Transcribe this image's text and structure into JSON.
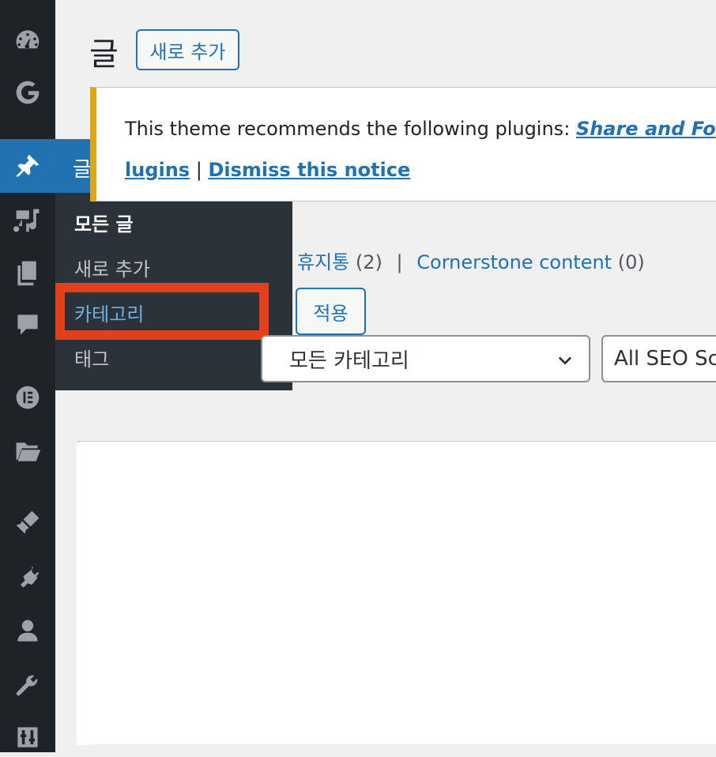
{
  "sidebar": {
    "icons": [
      {
        "name": "dashboard-icon"
      },
      {
        "name": "google-icon"
      },
      {
        "name": "posts-pin-icon",
        "active": true
      },
      {
        "name": "media-icon"
      },
      {
        "name": "pages-icon"
      },
      {
        "name": "comments-icon"
      },
      {
        "name": "elementor-icon"
      },
      {
        "name": "folder-icon"
      },
      {
        "name": "appearance-brush-icon"
      },
      {
        "name": "plugins-icon"
      },
      {
        "name": "users-icon"
      },
      {
        "name": "tools-wrench-icon"
      },
      {
        "name": "settings-sliders-icon"
      }
    ]
  },
  "flyout": {
    "title": "글",
    "items": [
      {
        "label": "모든 글",
        "current": true
      },
      {
        "label": "새로 추가"
      },
      {
        "label": "카테고리",
        "highlighted": true
      },
      {
        "label": "태그"
      }
    ]
  },
  "header": {
    "title": "글",
    "add_new": "새로 추가"
  },
  "notice": {
    "text": "This theme recommends the following plugins: ",
    "plugin_link": "Share and Fo",
    "install_link": "lugins",
    "separator": "|",
    "dismiss_link": "Dismiss this notice"
  },
  "filters": {
    "trash_label": "휴지통",
    "trash_count": "(2)",
    "separator": "|",
    "cornerstone_label": "Cornerstone content",
    "cornerstone_count": "(0)"
  },
  "bulk": {
    "apply_label": "적용"
  },
  "selects": {
    "category": "모든 카테고리",
    "seo": "All SEO Sc"
  },
  "colors": {
    "sidebar_bg": "#1d2327",
    "flyout_bg": "#2c3338",
    "accent": "#2271b1",
    "highlight_border": "#e2401c",
    "notice_border": "#dba617"
  }
}
